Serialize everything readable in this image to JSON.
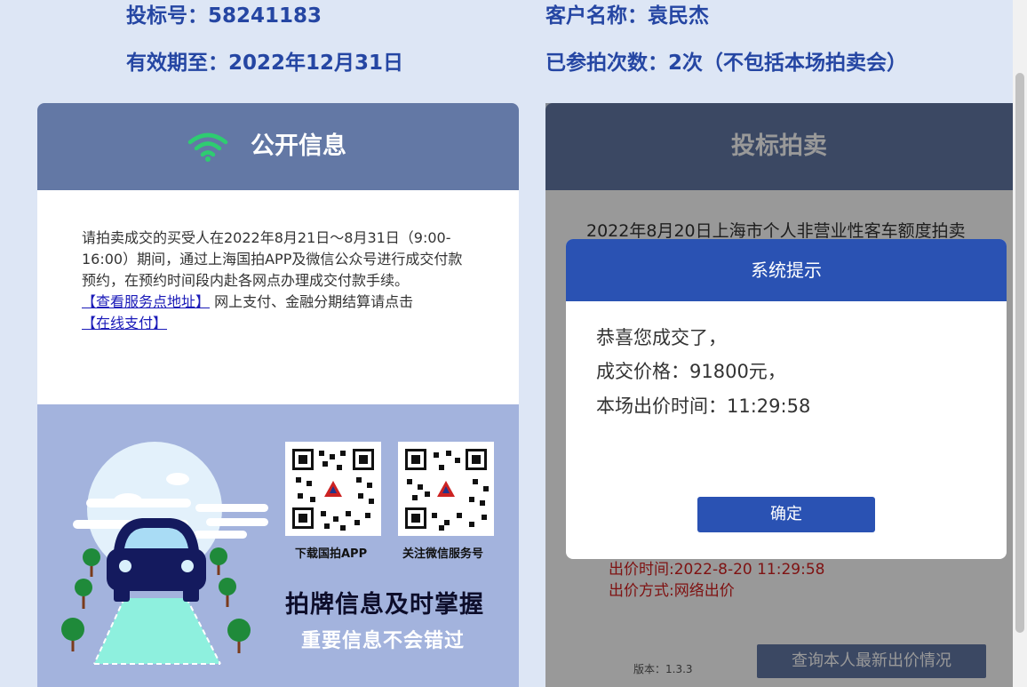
{
  "header": {
    "bid_number": "投标号：58241183",
    "valid_until": "有效期至：2022年12月31日",
    "customer_name": "客户名称：袁民杰",
    "participation_count": "已参拍次数：2次（不包括本场拍卖会）"
  },
  "public_info": {
    "title": "公开信息",
    "icon": "wifi-icon",
    "notice_text": "请拍卖成交的买受人在2022年8月21日～8月31日（9:00-16:00）期间，通过上海国拍APP及微信公众号进行成交付款预约，在预约时间段内赴各网点办理成交付款手续。",
    "service_link": "【查看服务点地址】",
    "payment_text": " 网上支付、金融分期结算请点击",
    "payment_link": "【在线支付】",
    "qr_app_label": "下载国拍APP",
    "qr_wechat_label": "关注微信服务号",
    "promo_headline": "拍牌信息及时掌握",
    "promo_subline": "重要信息不会错过"
  },
  "auction": {
    "title": "投标拍卖",
    "auction_title": "2022年8月20日上海市个人非营业性客车额度拍卖",
    "bid_time": "出价时间:2022-8-20 11:29:58",
    "bid_method": "出价方式:网络出价",
    "version": "版本：1.3.3",
    "query_button": "查询本人最新出价情况"
  },
  "dialog": {
    "title": "系统提示",
    "line1": "恭喜您成交了，",
    "line2": "成交价格：91800元，",
    "line3": "本场出价时间：11:29:58",
    "ok_button": "确定"
  },
  "colors": {
    "page_bg": "#dde6f5",
    "header_text": "#2546a3",
    "panel_header": "#6378a5",
    "dialog_accent": "#2a52b3",
    "promo_bg": "#a3b3dd",
    "bid_info_red": "#d42020"
  }
}
